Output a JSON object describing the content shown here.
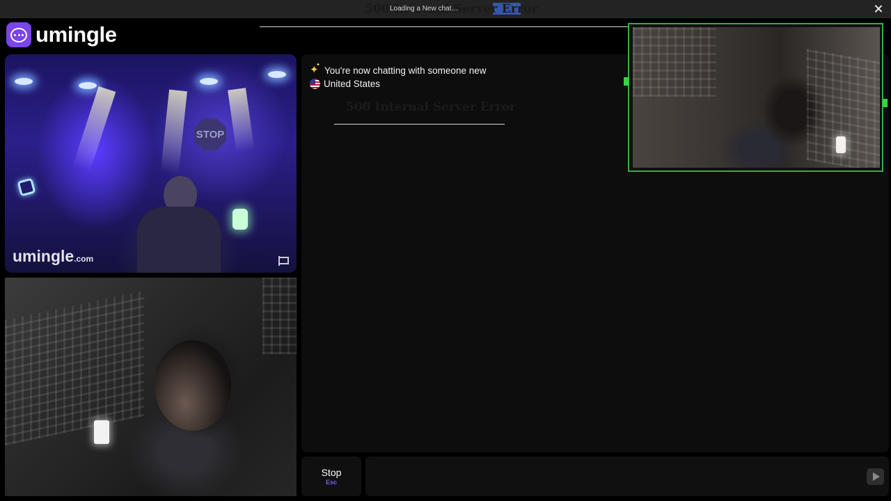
{
  "window": {
    "title": "500 Internal Server Error",
    "title_overlay": "Loading a New chat…"
  },
  "brand": {
    "name": "umingle",
    "watermark_name": "umingle",
    "watermark_domain": ".com",
    "accent": "#7b45e8"
  },
  "chat": {
    "status_message": "You're now chatting with someone new",
    "status_icon": "sparkles-icon",
    "country": "United States",
    "country_icon": "us-flag-icon",
    "error_ghost": "500 Internal Server Error"
  },
  "controls": {
    "stop_label": "Stop",
    "stop_shortcut": "Esc",
    "message_placeholder": "",
    "send_icon": "send-icon",
    "report_icon": "flag-icon",
    "close_icon": "close-icon"
  },
  "pip": {
    "border_color": "#2fb144",
    "handle_color": "#37d63f"
  }
}
